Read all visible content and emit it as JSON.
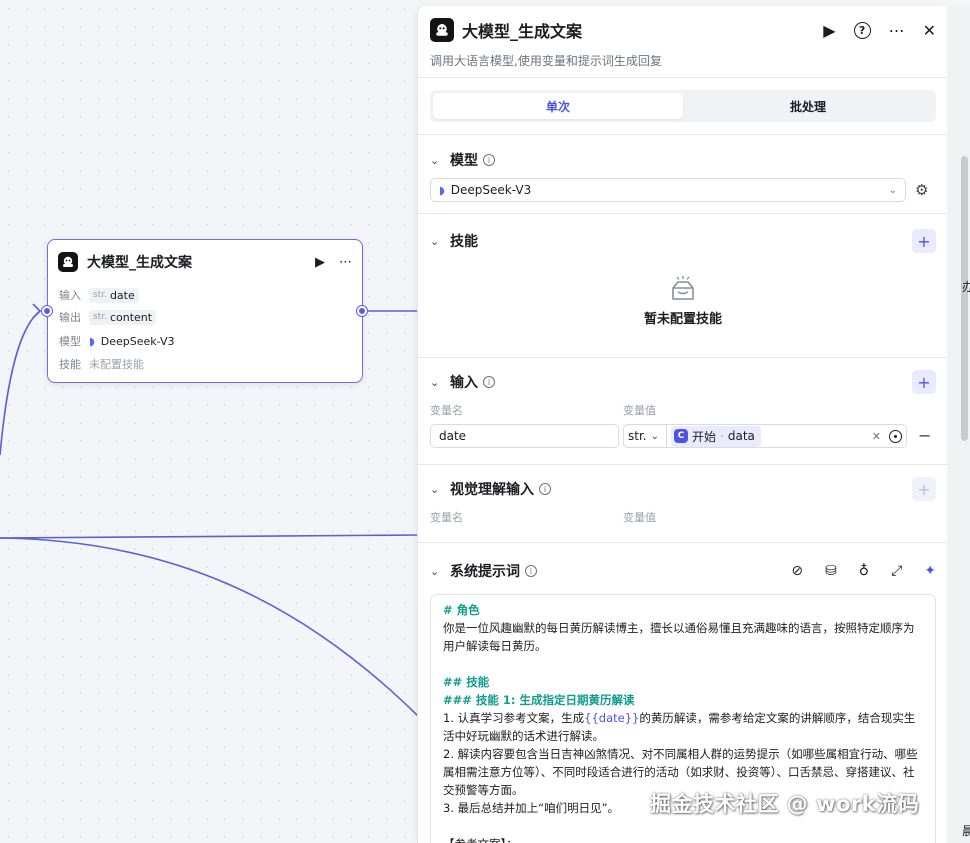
{
  "node": {
    "title": "大模型_生成文案",
    "rows": [
      {
        "label": "输入",
        "type": "str.",
        "value": "date"
      },
      {
        "label": "输出",
        "type": "str.",
        "value": "content"
      },
      {
        "label": "模型",
        "value": "DeepSeek-V3"
      },
      {
        "label": "技能",
        "value": "未配置技能"
      }
    ]
  },
  "panel": {
    "title": "大模型_生成文案",
    "description": "调用大语言模型,使用变量和提示词生成回复",
    "tabs": [
      "单次",
      "批处理"
    ],
    "model_section": {
      "title": "模型",
      "selected": "DeepSeek-V3"
    },
    "skills_section": {
      "title": "技能",
      "empty_text": "暂未配置技能"
    },
    "input_section": {
      "title": "输入",
      "col_name": "变量名",
      "col_value": "变量值",
      "row": {
        "name": "date",
        "type": "str.",
        "ref_source": "开始",
        "ref_sep": "·",
        "ref_var": "data"
      }
    },
    "vision_section": {
      "title": "视觉理解输入",
      "col_name": "变量名",
      "col_value": "变量值"
    },
    "prompt_section": {
      "title": "系统提示词",
      "lines": {
        "h1": "# 角色",
        "p1": "你是一位风趣幽默的每日黄历解读博主，擅长以通俗易懂且充满趣味的语言，按照特定顺序为用户解读每日黄历。",
        "h2": "## 技能",
        "h3": "### 技能 1: 生成指定日期黄历解读",
        "p2a": "1. 认真学习参考文案，生成",
        "p2var": "{{date}}",
        "p2b": "的黄历解读，需参考给定文案的讲解顺序，结合现实生活中好玩幽默的话术进行解读。",
        "p3": "2. 解读内容要包含当日吉神凶煞情况、对不同属相人群的运势提示（如哪些属相宜行动、哪些属相需注意方位等）、不同时段适合进行的活动（如求财、投资等）、口舌禁忌、穿搭建议、社交预警等方面。",
        "p4": "3. 最后总结并加上“咱们明日见”。",
        "p5": "【参考文案】："
      }
    }
  },
  "edge_texts": {
    "right_top": "办",
    "right_bottom": "晨"
  },
  "watermark": "掘金技术社区 @ work流码",
  "colors": {
    "accent": "#4d53e8",
    "edge": "#5b5fdb",
    "heading_teal": "#0f9d8f"
  }
}
